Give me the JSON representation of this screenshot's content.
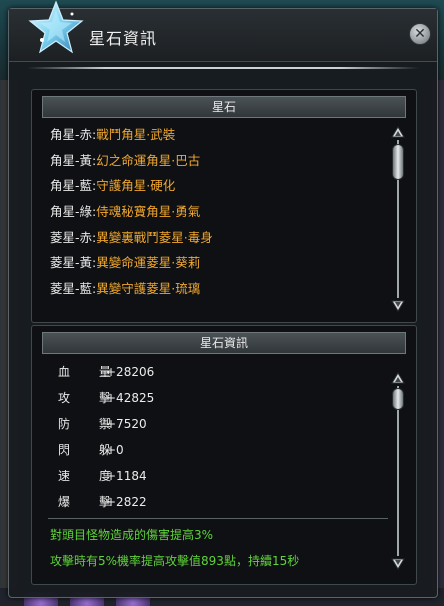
{
  "window": {
    "title": "星石資訊",
    "close_label": "✕"
  },
  "stars_panel": {
    "header": "星石",
    "items": [
      {
        "label": "角星-赤:",
        "value": "戰鬥角星·武裝"
      },
      {
        "label": "角星-黃:",
        "value": "幻之命運角星·巴古"
      },
      {
        "label": "角星-藍:",
        "value": "守護角星·硬化"
      },
      {
        "label": "角星-綠:",
        "value": "侍魂秘寶角星·勇氣"
      },
      {
        "label": "菱星-赤:",
        "value": "異變裏戰鬥菱星·毒身"
      },
      {
        "label": "菱星-黃:",
        "value": "異變命運菱星·葵莉"
      },
      {
        "label": "菱星-藍:",
        "value": "異變守護菱星·琉璃"
      }
    ]
  },
  "info_panel": {
    "header": "星石資訊",
    "stats": [
      {
        "name": "血量",
        "value": "+28206"
      },
      {
        "name": "攻擊",
        "value": "+42825"
      },
      {
        "name": "防禦",
        "value": "+7520"
      },
      {
        "name": "閃躲",
        "value": "+0"
      },
      {
        "name": "速度",
        "value": "+1184"
      },
      {
        "name": "爆擊",
        "value": "+2822"
      }
    ],
    "effects": [
      "對頭目怪物造成的傷害提高3%",
      "攻擊時有5%機率提高攻擊值893點，持續15秒"
    ]
  },
  "colors": {
    "star_value": "#f0a830",
    "effect_text": "#5fd33b"
  },
  "icons": {
    "title_icon": "star-crystal-icon",
    "close_icon": "close-icon"
  }
}
